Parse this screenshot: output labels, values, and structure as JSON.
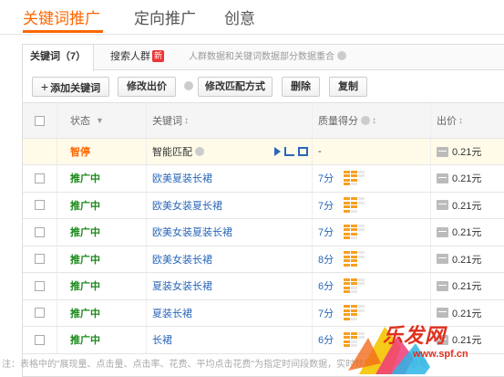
{
  "topnav": {
    "tabs": [
      {
        "label": "关键词推广",
        "active": true
      },
      {
        "label": "定向推广",
        "active": false
      },
      {
        "label": "创意",
        "active": false
      }
    ]
  },
  "subtabs": {
    "keywords_label": "关键词（7）",
    "crowd_label": "搜索人群",
    "new_badge": "新",
    "hint": "人群数据和关键词数据部分数据重合"
  },
  "toolbar": {
    "add_keyword": "添加关键词",
    "modify_bid": "修改出价",
    "modify_match": "修改匹配方式",
    "delete": "删除",
    "copy": "复制"
  },
  "table": {
    "headers": {
      "status": "状态",
      "keyword": "关键词",
      "quality": "质量得分",
      "bid": "出价"
    },
    "smart_row": {
      "status": "智停",
      "keyword": "智能匹配",
      "quality": "-",
      "bid": "0.21元"
    },
    "rows": [
      {
        "status": "推广中",
        "keyword": "欧美夏装长裙",
        "quality": "7分",
        "score": 7,
        "bid": "0.21元"
      },
      {
        "status": "推广中",
        "keyword": "欧美女装夏长裙",
        "quality": "7分",
        "score": 7,
        "bid": "0.21元"
      },
      {
        "status": "推广中",
        "keyword": "欧美女装夏装长裙",
        "quality": "7分",
        "score": 7,
        "bid": "0.21元"
      },
      {
        "status": "推广中",
        "keyword": "欧美女装长裙",
        "quality": "8分",
        "score": 8,
        "bid": "0.21元"
      },
      {
        "status": "推广中",
        "keyword": "夏装女装长裙",
        "quality": "6分",
        "score": 6,
        "bid": "0.21元"
      },
      {
        "status": "推广中",
        "keyword": "夏装长裙",
        "quality": "7分",
        "score": 7,
        "bid": "0.21元"
      },
      {
        "status": "推广中",
        "keyword": "长裙",
        "quality": "6分",
        "score": 6,
        "bid": "0.21元"
      }
    ]
  },
  "footnote": "注：表格中的\"展现量、点击量、点击率、花费、平均点击花费\"为指定时间段数据，实时数据不可对比参考",
  "watermark": {
    "text": "乐发网",
    "url": "www.spf.cn"
  },
  "colors": {
    "accent": "#ff6600",
    "status_green": "#1a8a1a",
    "link_blue": "#2a67b8",
    "bar_on": "#f7a021",
    "bar_off": "#e8e8e8"
  }
}
